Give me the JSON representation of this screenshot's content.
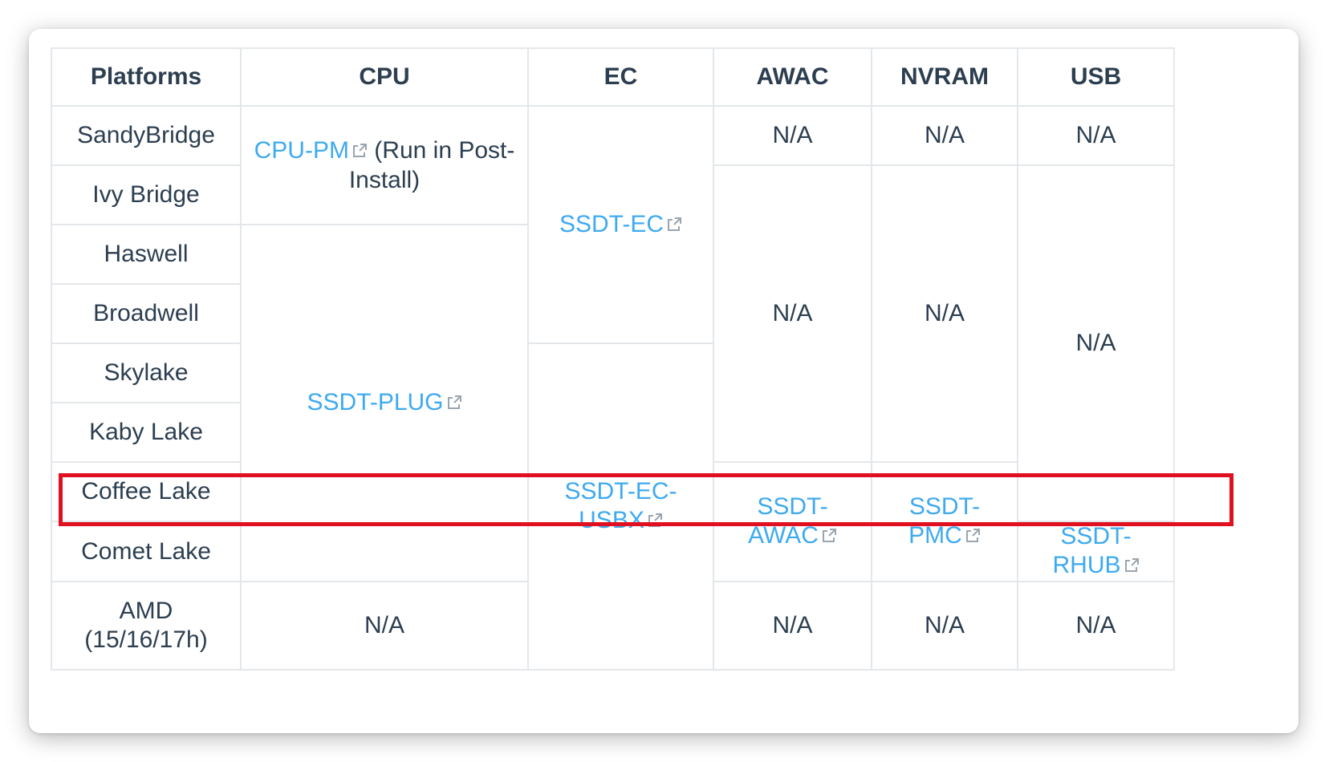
{
  "table": {
    "headers": [
      "Platforms",
      "CPU",
      "EC",
      "AWAC",
      "NVRAM",
      "USB"
    ],
    "platforms": [
      "SandyBridge",
      "Ivy Bridge",
      "Haswell",
      "Broadwell",
      "Skylake",
      "Kaby Lake",
      "Coffee Lake",
      "Comet Lake",
      "AMD (15/16/17h)"
    ],
    "cpu": {
      "cpu_pm_link": "CPU-PM",
      "cpu_pm_suffix": " (Run in Post-Install)",
      "ssdt_plug_link": "SSDT-PLUG",
      "amd": "N/A"
    },
    "ec": {
      "ssdt_ec_link": "SSDT-EC",
      "ssdt_ec_usbx_link": "SSDT-EC-USBX"
    },
    "awac": {
      "sandy": "N/A",
      "mid": "N/A",
      "ssdt_awac_link": "SSDT-AWAC",
      "amd": "N/A"
    },
    "nvram": {
      "sandy": "N/A",
      "mid": "N/A",
      "ssdt_pmc_link": "SSDT-PMC",
      "amd": "N/A"
    },
    "usb": {
      "sandy": "N/A",
      "mid": "N/A",
      "ssdt_rhub_link": "SSDT-RHUB",
      "amd": "N/A"
    }
  },
  "highlight": {
    "color": "#e01020",
    "target_row": "Coffee Lake"
  },
  "colors": {
    "link": "#3eaaf0",
    "text": "#2c3e50",
    "border": "#e4e7ea"
  }
}
